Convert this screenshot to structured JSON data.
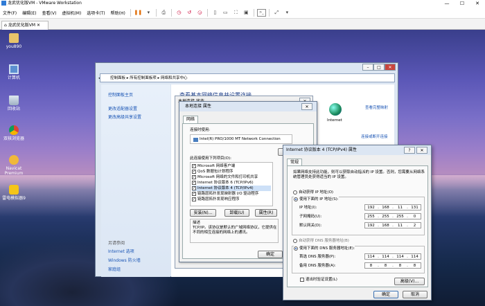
{
  "vmware": {
    "title": "龙武优化版VM - VMware Workstation",
    "menus": [
      "文件(F)",
      "编辑(E)",
      "查看(V)",
      "虚拟机(M)",
      "选项卡(T)",
      "帮助(H)"
    ],
    "tab_label": "龙武优化版VM"
  },
  "desktop_icons": [
    "you890",
    "计算机",
    "回收站",
    "双核浏览器",
    "Navicat Premium",
    "雷电模拟器9"
  ],
  "network_center": {
    "breadcrumb": "控制面板 ▸ 所有控制面板项 ▸ 网络和共享中心",
    "left_links": [
      "控制面板主页",
      "更改适配器设置",
      "更改高级共享设置"
    ],
    "see_also_title": "另请参阅",
    "see_also": [
      "Internet 选项",
      "Windows 防火墙",
      "家庭组"
    ],
    "heading": "查看基本网络信息并设置连接",
    "internet_label": "Internet",
    "view_full_map": "查看完整映射",
    "connect_or_disconnect": "连接或断开连接",
    "status_title": "本地连接 状态"
  },
  "props": {
    "title": "本地连接 属性",
    "tab": "网络",
    "connect_using_label": "连接时使用:",
    "adapter": "Intel(R) PRO/1000 MT Network Connection",
    "items_label": "此连接使用下列项目(O):",
    "items": [
      "Microsoft 网络客户端",
      "QoS 数据包计划程序",
      "Microsoft 网络的文件和打印机共享",
      "Internet 协议版本 6 (TCP/IPv6)",
      "Internet 协议版本 4 (TCP/IPv4)",
      "链路层拓扑发现映射器 I/O 驱动程序",
      "链路层拓扑发现响应程序"
    ],
    "install_btn": "安装(N)...",
    "uninstall_btn": "卸载(U)",
    "properties_btn": "属性(R)",
    "description_title": "描述",
    "description": "TCP/IP。该协议是默认的广域网络协议，它提供在不同的相互连接的网络上的通讯。",
    "ok_btn": "确定"
  },
  "ipv4": {
    "title": "Internet 协议版本 4 (TCP/IPv4) 属性",
    "tab": "常规",
    "intro": "如果网络支持此功能，则可以获取自动指派的 IP 设置。否则，您需要从网络系统管理员处获得适当的 IP 设置。",
    "auto_ip": "自动获得 IP 地址(O)",
    "use_ip": "使用下面的 IP 地址(S):",
    "ip_label": "IP 地址(I):",
    "ip": [
      "192",
      "168",
      "11",
      "131"
    ],
    "mask_label": "子网掩码(U):",
    "mask": [
      "255",
      "255",
      "255",
      "0"
    ],
    "gw_label": "默认网关(D):",
    "gw": [
      "192",
      "168",
      "11",
      "2"
    ],
    "auto_dns": "自动获得 DNS 服务器地址(B)",
    "use_dns": "使用下面的 DNS 服务器地址(E):",
    "dns1_label": "首选 DNS 服务器(P):",
    "dns1": [
      "114",
      "114",
      "114",
      "114"
    ],
    "dns2_label": "备用 DNS 服务器(A):",
    "dns2": [
      "8",
      "8",
      "8",
      "8"
    ],
    "validate": "退出时验证设置(L)",
    "advanced_btn": "高级(V)...",
    "ok_btn": "确定",
    "cancel_btn": "取消"
  }
}
